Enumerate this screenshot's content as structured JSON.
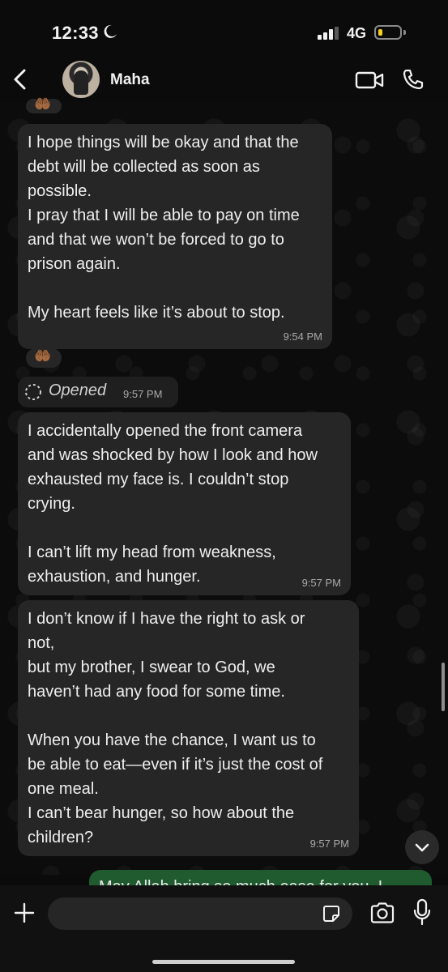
{
  "status_bar": {
    "time": "12:33",
    "network": "4G"
  },
  "header": {
    "back_icon": "chevron-left-icon",
    "contact_name": "Maha"
  },
  "messages": [
    {
      "text": "I hope things will be okay and that the\ndebt will be collected as soon as\npossible.\nI pray that I will be able to pay on time\nand that we won’t be forced to go to\nprison again.\n\nMy heart feels like it’s about to stop.",
      "time": "9:54 PM"
    },
    {
      "text": "I accidentally opened the front camera\nand was shocked by how I look and how\nexhausted my face is. I couldn’t stop\ncrying.\n\nI can’t lift my head from weakness,\nexhaustion, and hunger.",
      "time": "9:57 PM"
    },
    {
      "text": "I don’t know if I have the right to ask or\nnot,\nbut my brother, I swear to God, we\nhaven’t had any food for some time.\n\nWhen you have the chance, I want us to\nbe able to eat—even if it’s just the cost of\none meal.\nI can’t bear hunger, so how about the\nchildren?",
      "time": "9:57 PM"
    }
  ],
  "opened": {
    "label": "Opened",
    "time": "9:57 PM"
  },
  "reaction": "🤲🏾",
  "outgoing_preview": "May Allah bring so much ease for you. I",
  "colors": {
    "incoming_bubble": "#262626",
    "outgoing_bubble": "#1f5b2f",
    "background": "#0b0b0b",
    "battery": "#f2d21f"
  }
}
